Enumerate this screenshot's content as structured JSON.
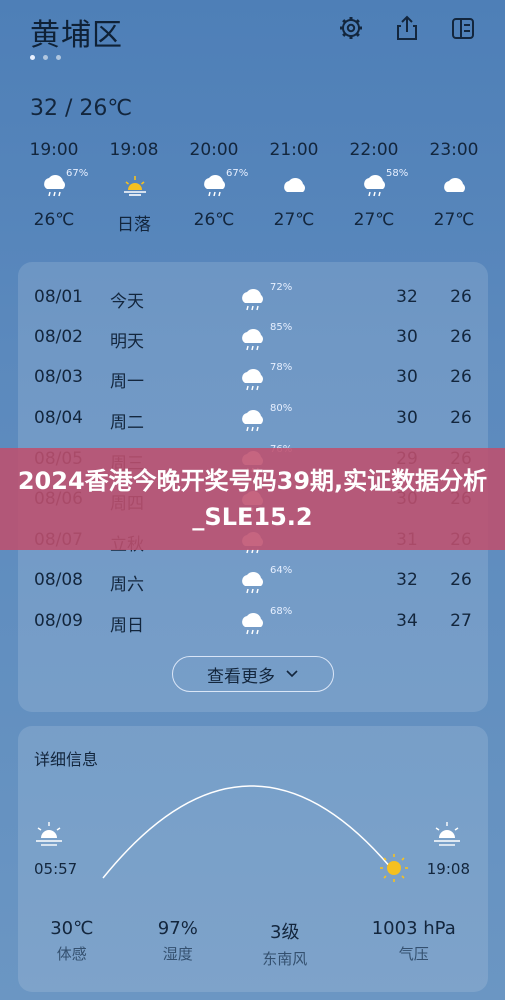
{
  "header": {
    "city": "黄埔区"
  },
  "summary": {
    "temp_range": "32 / 26℃"
  },
  "hourly": [
    {
      "time": "19:00",
      "icon": "rain-cloud-icon",
      "pop": "67%",
      "temp": "26℃"
    },
    {
      "time": "19:08",
      "icon": "sunset-icon",
      "pop": "",
      "temp": "日落"
    },
    {
      "time": "20:00",
      "icon": "rain-cloud-icon",
      "pop": "67%",
      "temp": "26℃"
    },
    {
      "time": "21:00",
      "icon": "cloud-icon",
      "pop": "",
      "temp": "27℃"
    },
    {
      "time": "22:00",
      "icon": "rain-cloud-icon",
      "pop": "58%",
      "temp": "27℃"
    },
    {
      "time": "23:00",
      "icon": "cloud-icon",
      "pop": "",
      "temp": "27℃"
    }
  ],
  "daily": [
    {
      "date": "08/01",
      "day": "今天",
      "pop": "72%",
      "hi": "32",
      "lo": "26"
    },
    {
      "date": "08/02",
      "day": "明天",
      "pop": "85%",
      "hi": "30",
      "lo": "26"
    },
    {
      "date": "08/03",
      "day": "周一",
      "pop": "78%",
      "hi": "30",
      "lo": "26"
    },
    {
      "date": "08/04",
      "day": "周二",
      "pop": "80%",
      "hi": "30",
      "lo": "26"
    },
    {
      "date": "08/05",
      "day": "周三",
      "pop": "76%",
      "hi": "29",
      "lo": "26"
    },
    {
      "date": "08/06",
      "day": "周四",
      "pop": "",
      "hi": "30",
      "lo": "26"
    },
    {
      "date": "08/07",
      "day": "立秋",
      "pop": "",
      "hi": "31",
      "lo": "26"
    },
    {
      "date": "08/08",
      "day": "周六",
      "pop": "64%",
      "hi": "32",
      "lo": "26"
    },
    {
      "date": "08/09",
      "day": "周日",
      "pop": "68%",
      "hi": "34",
      "lo": "27"
    }
  ],
  "more_button": {
    "label": "查看更多"
  },
  "details": {
    "title": "详细信息",
    "sunrise": "05:57",
    "sunset": "19:08",
    "stats": [
      {
        "value": "30℃",
        "label": "体感"
      },
      {
        "value": "97%",
        "label": "湿度"
      },
      {
        "value": "3级",
        "label": "东南风"
      },
      {
        "value": "1003 hPa",
        "label": "气压"
      }
    ]
  },
  "banner": {
    "text": "2024香港今晚开奖号码39期,实证数据分析_SLE15.2"
  },
  "colors": {
    "sky_top": "#4e7fb7",
    "sky_bottom": "#6b96c3",
    "banner": "#be506e",
    "sun": "#f5c020"
  }
}
